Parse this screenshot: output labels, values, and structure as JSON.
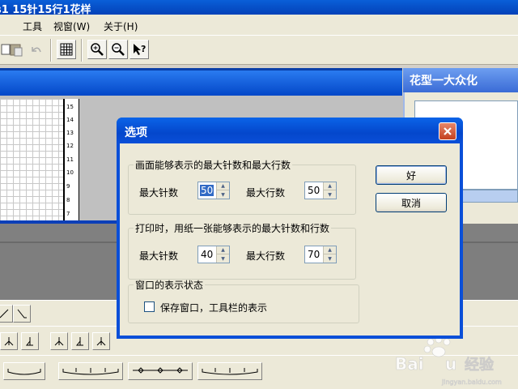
{
  "app": {
    "title": "s1 15针15行1花样",
    "menu": [
      "工具",
      "视窗(W)",
      "关于(H)"
    ]
  },
  "toolbar": {
    "icons": [
      "paste-icon",
      "undo-icon",
      "grid-icon",
      "zoom-in-icon",
      "zoom-out-icon",
      "help-pointer-icon"
    ]
  },
  "pattern": {
    "row_numbers": [
      "15",
      "14",
      "13",
      "12",
      "11",
      "10",
      "9",
      "8",
      "7"
    ]
  },
  "side_panel": {
    "title": "花型一大众化"
  },
  "dialog": {
    "title": "选项",
    "group1": {
      "legend": "画面能够表示的最大针数和最大行数",
      "needles_label": "最大针数",
      "needles_value": "50",
      "rows_label": "最大行数",
      "rows_value": "50"
    },
    "group2": {
      "legend": "打印时，用纸一张能够表示的最大针数和行数",
      "needles_label": "最大针数",
      "needles_value": "40",
      "rows_label": "最大行数",
      "rows_value": "70"
    },
    "group3": {
      "legend": "窗口的表示状态",
      "checkbox_label": "保存窗口，工具栏的表示",
      "checked": false
    },
    "ok_label": "好",
    "cancel_label": "取消"
  },
  "colors": {
    "title_blue": "#0a4fd8",
    "dialog_face": "#ece9d8",
    "selection": "#316ac5",
    "close_red": "#c4401f"
  }
}
